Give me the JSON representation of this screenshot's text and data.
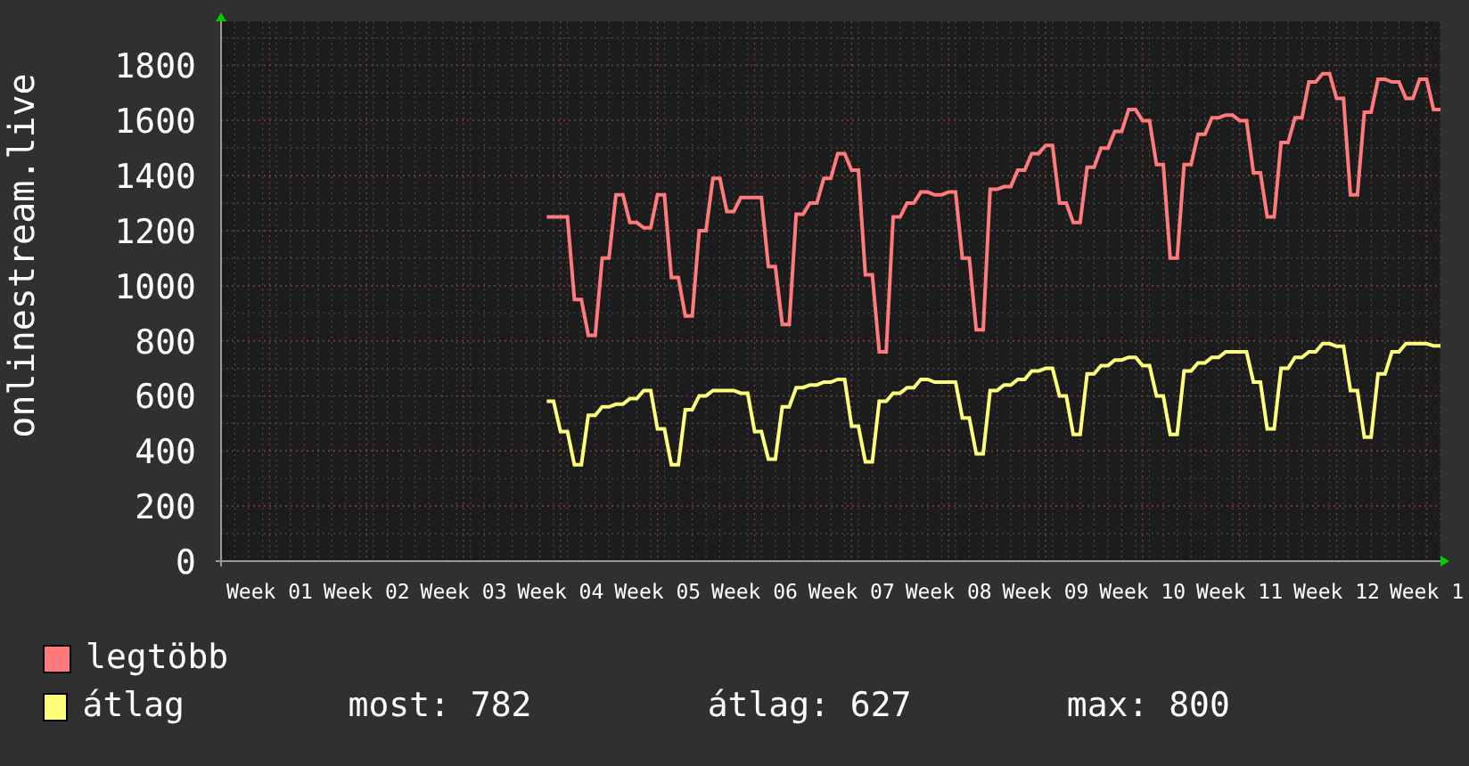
{
  "chart": {
    "chart_data": {
      "type": "line",
      "ylabel": "onlinestream.live",
      "grid": true,
      "categories": [
        null,
        null,
        null,
        null,
        null,
        null,
        null,
        "Week 01",
        null,
        null,
        null,
        null,
        null,
        null,
        null,
        null,
        null,
        null,
        null,
        null,
        null,
        "Week 02",
        null,
        null,
        null,
        null,
        null,
        null,
        null,
        null,
        null,
        null,
        null,
        null,
        null,
        "Week 03",
        null,
        null,
        null,
        null,
        null,
        null,
        null,
        null,
        null,
        null,
        null,
        null,
        null,
        "Week 04",
        null,
        null,
        null,
        null,
        null,
        null,
        null,
        null,
        null,
        null,
        null,
        null,
        null,
        "Week 05",
        null,
        null,
        null,
        null,
        null,
        null,
        null,
        null,
        null,
        null,
        null,
        null,
        null,
        "Week 06",
        null,
        null,
        null,
        null,
        null,
        null,
        null,
        null,
        null,
        null,
        null,
        null,
        null,
        "Week 07",
        null,
        null,
        null,
        null,
        null,
        null,
        null,
        null,
        null,
        null,
        null,
        null,
        null,
        "Week 08",
        null,
        null,
        null,
        null,
        null,
        null,
        null,
        null,
        null,
        null,
        null,
        null,
        null,
        "Week 09",
        null,
        null,
        null,
        null,
        null,
        null,
        null,
        null,
        null,
        null,
        null,
        null,
        null,
        "Week 10",
        null,
        null,
        null,
        null,
        null,
        null,
        null,
        null,
        null,
        null,
        null,
        null,
        null,
        "Week 11",
        null,
        null,
        null,
        null,
        null,
        null,
        null,
        null,
        null,
        null,
        null,
        null,
        null,
        "Week 12",
        null,
        null,
        null,
        null,
        null,
        null,
        null,
        null,
        null,
        null,
        null,
        null,
        "Week 1",
        null,
        null
      ],
      "ylim": [
        0,
        1960
      ],
      "yticks": [
        0,
        200,
        400,
        600,
        800,
        1000,
        1200,
        1400,
        1600,
        1800
      ],
      "series": [
        {
          "name": "legtöbb",
          "color": "#ff7b7b",
          "values": [
            null,
            null,
            null,
            null,
            null,
            null,
            null,
            null,
            null,
            null,
            null,
            null,
            null,
            null,
            null,
            null,
            null,
            null,
            null,
            null,
            null,
            null,
            null,
            null,
            null,
            null,
            null,
            null,
            null,
            null,
            null,
            null,
            null,
            null,
            null,
            null,
            null,
            null,
            null,
            null,
            null,
            null,
            null,
            null,
            null,
            null,
            null,
            1250,
            1250,
            1250,
            1250,
            950,
            950,
            820,
            820,
            1100,
            1100,
            1330,
            1330,
            1230,
            1230,
            1210,
            1210,
            1330,
            1330,
            1030,
            1030,
            890,
            890,
            1200,
            1200,
            1390,
            1390,
            1270,
            1270,
            1320,
            1320,
            1320,
            1320,
            1070,
            1070,
            860,
            860,
            1260,
            1260,
            1300,
            1300,
            1390,
            1390,
            1480,
            1480,
            1420,
            1420,
            1040,
            1040,
            760,
            760,
            1250,
            1250,
            1300,
            1300,
            1340,
            1340,
            1330,
            1330,
            1340,
            1340,
            1100,
            1100,
            840,
            840,
            1350,
            1350,
            1360,
            1360,
            1420,
            1420,
            1480,
            1480,
            1510,
            1510,
            1300,
            1300,
            1230,
            1230,
            1430,
            1430,
            1500,
            1500,
            1560,
            1560,
            1640,
            1640,
            1600,
            1600,
            1440,
            1440,
            1100,
            1100,
            1440,
            1440,
            1550,
            1550,
            1610,
            1610,
            1620,
            1620,
            1600,
            1600,
            1410,
            1410,
            1250,
            1250,
            1520,
            1520,
            1610,
            1610,
            1740,
            1740,
            1770,
            1770,
            1680,
            1680,
            1330,
            1330,
            1630,
            1630,
            1750,
            1750,
            1740,
            1740,
            1680,
            1680,
            1750,
            1750,
            1640,
            1640
          ]
        },
        {
          "name": "átlag",
          "color": "#ffff7b",
          "values": [
            null,
            null,
            null,
            null,
            null,
            null,
            null,
            null,
            null,
            null,
            null,
            null,
            null,
            null,
            null,
            null,
            null,
            null,
            null,
            null,
            null,
            null,
            null,
            null,
            null,
            null,
            null,
            null,
            null,
            null,
            null,
            null,
            null,
            null,
            null,
            null,
            null,
            null,
            null,
            null,
            null,
            null,
            null,
            null,
            null,
            null,
            null,
            580,
            580,
            470,
            470,
            350,
            350,
            530,
            530,
            560,
            560,
            570,
            570,
            590,
            590,
            620,
            620,
            480,
            480,
            350,
            350,
            550,
            550,
            600,
            600,
            620,
            620,
            620,
            620,
            610,
            610,
            470,
            470,
            370,
            370,
            560,
            560,
            630,
            630,
            640,
            640,
            650,
            650,
            660,
            660,
            490,
            490,
            360,
            360,
            580,
            580,
            610,
            610,
            630,
            630,
            660,
            660,
            650,
            650,
            650,
            650,
            520,
            520,
            390,
            390,
            620,
            620,
            640,
            640,
            660,
            660,
            690,
            690,
            700,
            700,
            600,
            600,
            460,
            460,
            680,
            680,
            710,
            710,
            730,
            730,
            740,
            740,
            710,
            710,
            600,
            600,
            460,
            460,
            690,
            690,
            720,
            720,
            740,
            740,
            760,
            760,
            760,
            760,
            650,
            650,
            480,
            480,
            700,
            700,
            740,
            740,
            760,
            760,
            790,
            790,
            780,
            780,
            620,
            620,
            450,
            450,
            680,
            680,
            760,
            760,
            790,
            790,
            790,
            790,
            782,
            782
          ]
        }
      ]
    }
  },
  "legend_stats": [
    "most: 782",
    "átlag: 627",
    "max: 800"
  ]
}
